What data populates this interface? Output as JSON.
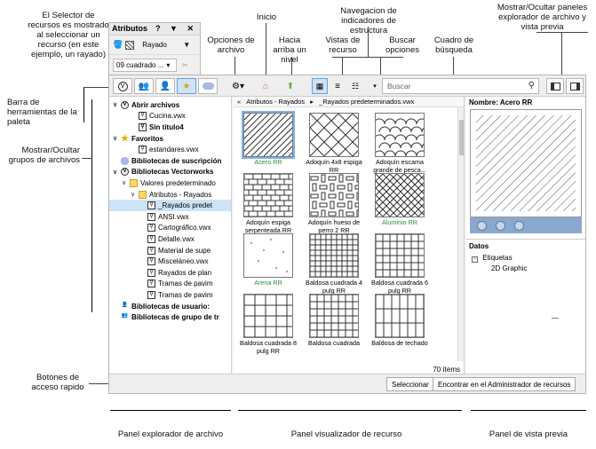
{
  "callouts": {
    "selector": "El Selector de recursos es mostrado al seleccionar un recurso (en este ejemplo, un rayado)",
    "opciones_archivo": "Opciones de archivo",
    "inicio": "Inicio",
    "hacia_arriba": "Hacia arriba un nivel",
    "navegacion": "Navegacion de indicadores de estructura",
    "vistas": "Vistas de recurso",
    "buscar_opciones": "Buscar opciones",
    "cuadro_busqueda": "Cuadro de búsqueda",
    "mostrar_ocultar_paneles": "Mostrar/Ocultar paneles explorador de archivo y vista previa",
    "barra_herramientas": "Barra de herramientas de la paleta",
    "mostrar_ocultar_grupos": "Mostrar/Ocultar grupos de archivos",
    "botones_rapido": "Botones de acceso rapido",
    "panel_explorador": "Panel explorador de archivo",
    "panel_visualizador": "Panel visualizador de recurso",
    "panel_vista_previa": "Panel de vista previa"
  },
  "palette": {
    "title": "Atributos",
    "controls": "? ▼ ✕",
    "dropdown1": "Rayado",
    "dropdown2": "09 cuadrado ..."
  },
  "toolbar": {
    "search_placeholder": "Buscar"
  },
  "breadcrumb": {
    "back": "«",
    "part1": "Atributos - Rayados",
    "sep": "▸",
    "part2": "_Rayados predeterminados.vwx"
  },
  "tree": [
    {
      "label": "Abrir archivos",
      "level": 0,
      "type": "group",
      "bold": true
    },
    {
      "label": "Cucina.vwx",
      "level": 2,
      "type": "vw"
    },
    {
      "label": "Sin titulo4",
      "level": 2,
      "type": "vw",
      "bold": true
    },
    {
      "label": "Favoritos",
      "level": 0,
      "type": "star",
      "bold": true
    },
    {
      "label": "estandares.vwx",
      "level": 2,
      "type": "vw"
    },
    {
      "label": "Bibliotecas de suscripción",
      "level": 0,
      "type": "cloud",
      "bold": true
    },
    {
      "label": "Bibliotecas Vectorworks",
      "level": 0,
      "type": "group",
      "bold": true
    },
    {
      "label": "Valores predeterminado",
      "level": 1,
      "type": "folder"
    },
    {
      "label": "Atributos - Rayados",
      "level": 2,
      "type": "folder"
    },
    {
      "label": "_Rayados predet",
      "level": 3,
      "type": "vw",
      "selected": true
    },
    {
      "label": "ANSI.vwx",
      "level": 3,
      "type": "vw"
    },
    {
      "label": "Cartográfico.vwx",
      "level": 3,
      "type": "vw"
    },
    {
      "label": "Detalle.vwx",
      "level": 3,
      "type": "vw"
    },
    {
      "label": "Material de supe",
      "level": 3,
      "type": "vw"
    },
    {
      "label": "Misceláneo.vwx",
      "level": 3,
      "type": "vw"
    },
    {
      "label": "Rayados de plan",
      "level": 3,
      "type": "vw"
    },
    {
      "label": "Tramas de pavim",
      "level": 3,
      "type": "vw"
    },
    {
      "label": "Tramas de pavim",
      "level": 3,
      "type": "vw"
    },
    {
      "label": "Bibliotecas de usuario:",
      "level": 0,
      "type": "user",
      "bold": true
    },
    {
      "label": "Bibliotecas de grupo de tr",
      "level": 0,
      "type": "group2",
      "bold": true
    }
  ],
  "tiles": [
    {
      "label": "Acero RR",
      "green": true,
      "pattern": "diag"
    },
    {
      "label": "Adoquín 4x8 espiga RR",
      "pattern": "herring"
    },
    {
      "label": "Adoquín escama grande de pesca...",
      "pattern": "scale"
    },
    {
      "label": "Adoquín espiga serpenteada RR",
      "pattern": "brick"
    },
    {
      "label": "Adoquín hueso de perro 2 RR",
      "pattern": "weave"
    },
    {
      "label": "Aluminio RR",
      "green": true,
      "pattern": "cross"
    },
    {
      "label": "Arena RR",
      "green": true,
      "pattern": "dots"
    },
    {
      "label": "Baldosa cuadrada 4 pulg RR",
      "pattern": "grid4"
    },
    {
      "label": "Baldosa cuadrada 6 pulg RR",
      "pattern": "grid6"
    },
    {
      "label": "Baldosa cuadrada 8 pulg RR",
      "pattern": "grid8"
    },
    {
      "label": "Baldosa cuadrada",
      "pattern": "grid6"
    },
    {
      "label": "Baldosa de techado",
      "pattern": "vert"
    }
  ],
  "item_count": "70 ítems",
  "preview": {
    "name_label": "Nombre: Acero RR",
    "datos_title": "Datos",
    "etiquetas": "Etiquetas",
    "graphic": "2D Graphic",
    "dash": "—"
  },
  "buttons": {
    "seleccionar": "Seleccionar",
    "encontrar": "Encontrar en el Administrador de recursos"
  }
}
